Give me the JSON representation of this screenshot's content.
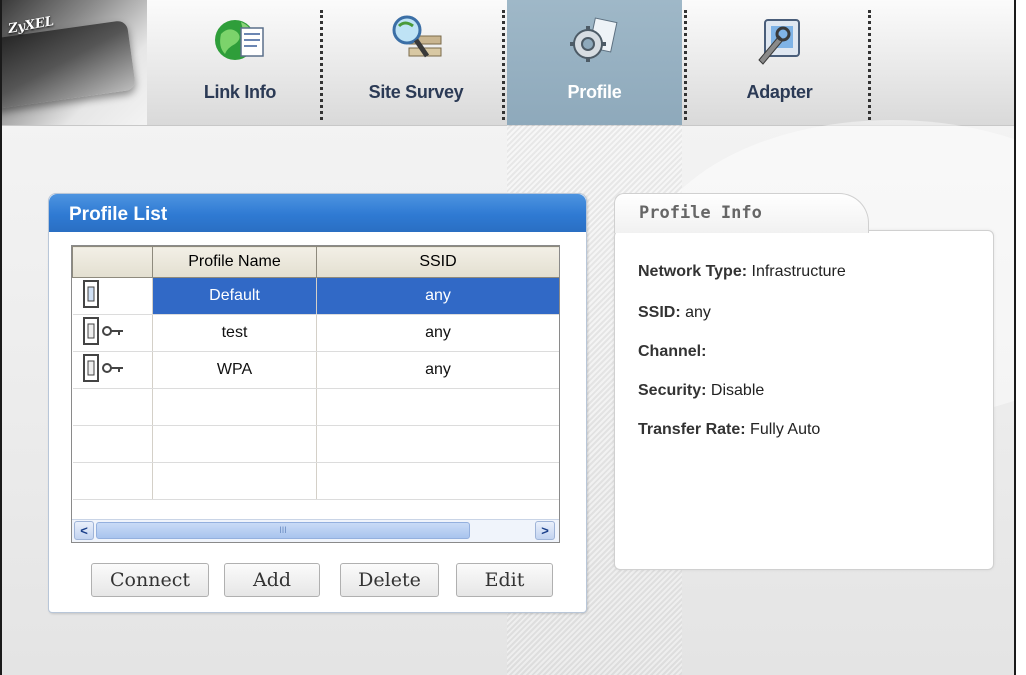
{
  "logo": {
    "text": "ZyXEL"
  },
  "nav": {
    "tabs": [
      {
        "label": "Link Info",
        "icon": "globe-document-icon",
        "active": false
      },
      {
        "label": "Site Survey",
        "icon": "magnifier-network-icon",
        "active": false
      },
      {
        "label": "Profile",
        "icon": "gear-document-icon",
        "active": true
      },
      {
        "label": "Adapter",
        "icon": "adapter-tool-icon",
        "active": false
      }
    ]
  },
  "profile_list": {
    "title": "Profile List",
    "columns": [
      "",
      "Profile Name",
      "SSID"
    ],
    "rows": [
      {
        "icon": "adapter-icon",
        "secure": false,
        "name": "Default",
        "ssid": "any",
        "selected": true
      },
      {
        "icon": "adapter-icon",
        "secure": true,
        "name": "test",
        "ssid": "any",
        "selected": false
      },
      {
        "icon": "adapter-icon",
        "secure": true,
        "name": "WPA",
        "ssid": "any",
        "selected": false
      }
    ],
    "scroll": {
      "left": "<",
      "right": ">",
      "thumb": "III"
    },
    "buttons": {
      "connect": "Connect",
      "add": "Add",
      "delete": "Delete",
      "edit": "Edit"
    }
  },
  "profile_info": {
    "title": "Profile Info",
    "network_type_label": "Network Type:",
    "network_type_value": "Infrastructure",
    "ssid_label": "SSID:",
    "ssid_value": "any",
    "channel_label": "Channel:",
    "channel_value": "",
    "security_label": "Security:",
    "security_value": "Disable",
    "rate_label": "Transfer Rate:",
    "rate_value": "Fully Auto"
  },
  "colors": {
    "accent": "#2f7ad3",
    "selection": "#3169c6",
    "active_tab": "#8ea9bb"
  }
}
